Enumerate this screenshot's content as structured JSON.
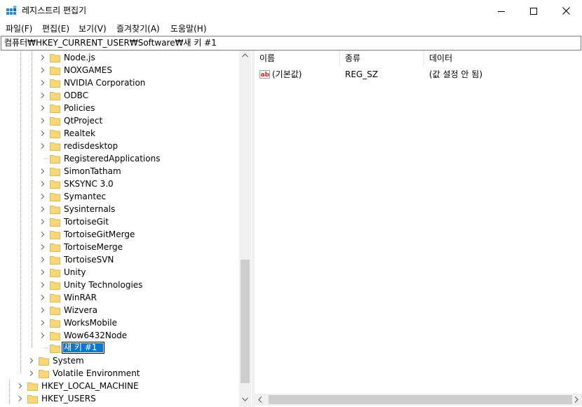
{
  "window": {
    "title": "레지스트리 편집기",
    "minimize_icon": "minimize-icon",
    "maximize_icon": "maximize-icon",
    "close_icon": "close-icon"
  },
  "menu": [
    "파일(F)",
    "편집(E)",
    "보기(V)",
    "즐겨찾기(A)",
    "도움말(H)"
  ],
  "address": "컴퓨터₩HKEY_CURRENT_USER₩Software₩새 키 #1",
  "tree": {
    "software_children": [
      "Node.js",
      "NOXGAMES",
      "NVIDIA Corporation",
      "ODBC",
      "Policies",
      "QtProject",
      "Realtek",
      "redisdesktop",
      "RegisteredApplications",
      "SimonTatham",
      "SKSYNC 3.0",
      "Symantec",
      "Sysinternals",
      "TortoiseGit",
      "TortoiseGitMerge",
      "TortoiseMerge",
      "TortoiseSVN",
      "Unity",
      "Unity Technologies",
      "WinRAR",
      "Wizvera",
      "WorksMobile",
      "Wow6432Node"
    ],
    "no_children": [
      "RegisteredApplications"
    ],
    "editing_key": "새 키 #1",
    "hkcu_children": [
      "System",
      "Volatile Environment"
    ],
    "roots": [
      "HKEY_LOCAL_MACHINE",
      "HKEY_USERS"
    ]
  },
  "list": {
    "columns": [
      "이름",
      "종류",
      "데이터"
    ],
    "rows": [
      {
        "name": "(기본값)",
        "type": "REG_SZ",
        "data": "(값 설정 안 됨)",
        "icon": "string-value-icon"
      }
    ]
  },
  "colors": {
    "selection": "#0078d7",
    "folder": "#f8d775",
    "folder_dark": "#e0b94a"
  }
}
